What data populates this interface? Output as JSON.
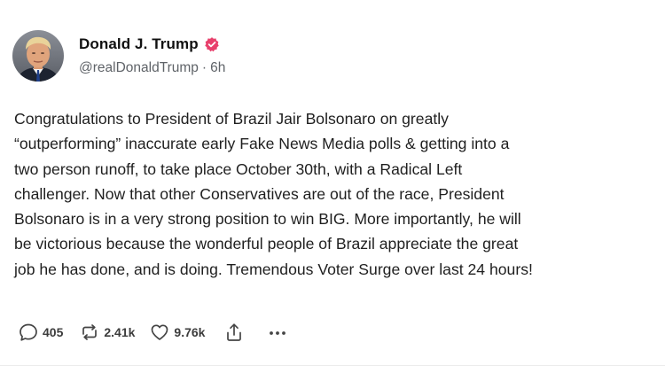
{
  "post": {
    "author": {
      "display_name": "Donald J. Trump",
      "verified": true,
      "handle": "@realDonaldTrump",
      "separator": "·",
      "age": "6h",
      "avatar_icon": "profile-photo",
      "verified_icon": "verified-badge-icon"
    },
    "text": "Congratulations to President of Brazil Jair Bolsonaro on greatly\n“outperforming” inaccurate early Fake News Media polls & getting into a\ntwo person runoff, to take place October 30th, with a Radical Left\nchallenger. Now that other Conservatives are out of the race, President\nBolsonaro is in a very strong position to win BIG. More importantly, he will\nbe victorious because the wonderful people of Brazil appreciate the great\njob he has done, and is doing. Tremendous Voter Surge over last 24 hours!",
    "actions": {
      "reply_count": "405",
      "repost_count": "2.41k",
      "like_count": "9.76k",
      "reply_icon": "comment-bubble-icon",
      "repost_icon": "repost-arrows-icon",
      "like_icon": "heart-icon",
      "share_icon": "share-upload-icon",
      "more_icon": "more-dots-icon"
    },
    "colors": {
      "verified_badge": "#e8406c",
      "text": "#1f1f1f",
      "muted": "#5f6368"
    }
  }
}
